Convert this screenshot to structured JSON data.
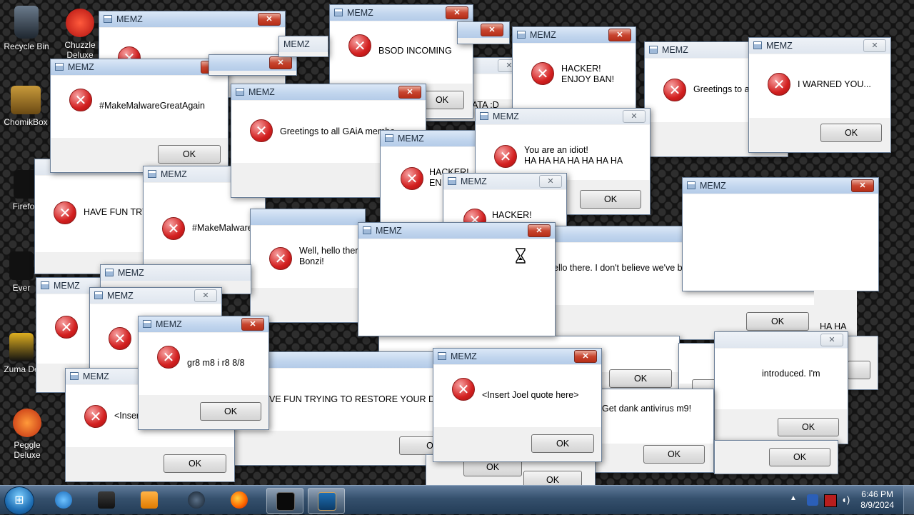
{
  "desktop_icons": [
    {
      "label": "Recycle Bin",
      "icon": "recycle-bin-icon"
    },
    {
      "label": "Chuzzle Deluxe",
      "icon": "chuzzle-icon"
    },
    {
      "label": "ChomikBox",
      "icon": "chomikbox-icon"
    },
    {
      "label": "Firefox",
      "icon": "firefox-icon"
    },
    {
      "label": "Ever",
      "icon": "game-icon"
    },
    {
      "label": "Zuma De",
      "icon": "zuma-icon"
    },
    {
      "label": "Peggle Deluxe",
      "icon": "peggle-icon"
    }
  ],
  "dialogs": [
    {
      "title": "MEMZ",
      "message": "",
      "ok": "",
      "active": true
    },
    {
      "title": "MEMZ",
      "message": "BSOD INCOMING",
      "ok": "OK",
      "active": true
    },
    {
      "title": "MEMZ",
      "message": "",
      "ok": "",
      "active": true
    },
    {
      "title": "MEMZ",
      "message": "ATA :D",
      "ok": "OK",
      "active": false
    },
    {
      "title": "MEMZ",
      "message": "HACKER!\nENJOY BAN!",
      "ok": "",
      "active": true
    },
    {
      "title": "MEMZ",
      "message": "Greetings to all",
      "ok": "",
      "active": false
    },
    {
      "title": "MEMZ",
      "message": "I WARNED YOU...",
      "ok": "OK",
      "active": false
    },
    {
      "title": "MEMZ",
      "message": "#MakeMalwareGreatAgain",
      "ok": "OK",
      "active": true
    },
    {
      "title": "MEMZ",
      "message": "Greetings to all GAiA membe",
      "ok": "",
      "active": true
    },
    {
      "title": "MEMZ",
      "message": "HAVE FUN TRYIN",
      "ok": "",
      "active": true
    },
    {
      "title": "MEMZ",
      "message": "#MakeMalware",
      "ok": "",
      "active": false
    },
    {
      "title": "MEMZ",
      "message": "HACKER!\nEN",
      "ok": "",
      "active": true
    },
    {
      "title": "MEMZ",
      "message": "You are an idiot!\nHA HA HA HA HA HA HA",
      "ok": "OK",
      "active": false
    },
    {
      "title": "MEMZ",
      "message": "HACKER!",
      "ok": "",
      "active": false
    },
    {
      "title": "MEMZ",
      "message": "",
      "ok": "",
      "active": true
    },
    {
      "title": "MEMZ",
      "message": "Well, hello there\nBonzi!",
      "ok": "",
      "active": true
    },
    {
      "title": "MEMZ",
      "message": "ello there. I don't believe we've be",
      "ok": "OK",
      "active": true
    },
    {
      "title": "MEMZ",
      "message": "",
      "ok": "",
      "active": true
    },
    {
      "title": "MEMZ",
      "message": "",
      "ok": "",
      "active": false
    },
    {
      "title": "MEMZ",
      "message": "",
      "ok": "",
      "active": false
    },
    {
      "title": "MEMZ",
      "message": "",
      "ok": "",
      "active": false
    },
    {
      "title": "MEMZ",
      "message": "gr8 m8 i r8 8/8",
      "ok": "OK",
      "active": true
    },
    {
      "title": "MEMZ",
      "message": "<Inser",
      "ok": "OK",
      "active": false
    },
    {
      "title": "MEMZ",
      "message": "VE FUN TRYING TO RESTORE YOUR DATA",
      "ok": "O",
      "active": true
    },
    {
      "title": "MEMZ",
      "message": "<Insert Joel quote here>",
      "ok": "OK",
      "active": true
    },
    {
      "title": "MEMZ",
      "message": "introduced. I'm",
      "ok": "OK",
      "active": false
    },
    {
      "title": "MEMZ",
      "message": "Get dank antivirus m9!",
      "ok": "OK",
      "active": false
    },
    {
      "title": "MEMZ",
      "message": "HA HA",
      "ok": "",
      "active": false
    }
  ],
  "extra_ok_buttons": [
    "OK",
    "OK",
    "OK",
    "OK",
    "OK",
    "OK"
  ],
  "taskbar": {
    "apps": [
      {
        "icon": "internet-explorer-icon"
      },
      {
        "icon": "media-center-icon"
      },
      {
        "icon": "windows-media-player-icon"
      },
      {
        "icon": "steam-icon"
      },
      {
        "icon": "firefox-icon"
      },
      {
        "icon": "console-icon"
      },
      {
        "icon": "memz-app-icon"
      }
    ],
    "time": "6:46 PM",
    "date": "8/9/2024",
    "tray_icons": [
      "show-hidden-icons-arrow",
      "bluetooth-icon",
      "action-center-icon",
      "volume-icon"
    ]
  },
  "colors": {
    "error_red": "#d32020",
    "close_red": "#c8452f",
    "titlebar_blue": "#c2d6ee"
  }
}
